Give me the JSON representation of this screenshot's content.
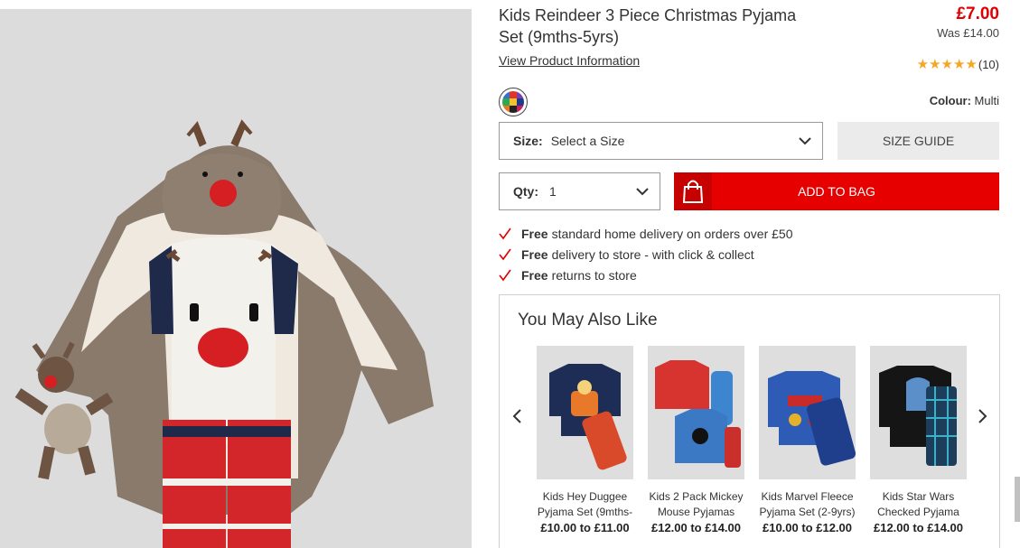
{
  "product": {
    "title": "Kids Reindeer 3 Piece Christmas Pyjama Set (9mths-5yrs)",
    "price_now": "£7.00",
    "price_was": "Was £14.00",
    "view_info_link": "View Product Information",
    "rating_stars": 5,
    "rating_count": "(10)",
    "colour_label": "Colour:",
    "colour_value": "Multi"
  },
  "colors": {
    "accent_red": "#e60000",
    "price_red": "#e00000",
    "star": "#f5a623"
  },
  "size": {
    "label": "Size:",
    "value": "Select a Size",
    "guide_label": "SIZE GUIDE"
  },
  "quantity": {
    "label": "Qty:",
    "value": "1"
  },
  "add_to_bag_label": "ADD TO BAG",
  "benefits": [
    {
      "bold": "Free",
      "text": "standard home delivery on orders over £50"
    },
    {
      "bold": "Free",
      "text": "delivery to store - with click & collect"
    },
    {
      "bold": "Free",
      "text": "returns to store"
    }
  ],
  "recommendations": {
    "title": "You May Also Like",
    "items": [
      {
        "name": "Kids Hey Duggee Pyjama Set (9mths-",
        "price": "£10.00 to £11.00"
      },
      {
        "name": "Kids 2 Pack Mickey Mouse Pyjamas",
        "price": "£12.00 to £14.00"
      },
      {
        "name": "Kids Marvel Fleece Pyjama Set (2-9yrs)",
        "price": "£10.00 to £12.00"
      },
      {
        "name": "Kids Star Wars Checked Pyjama",
        "price": "£12.00 to £14.00"
      }
    ]
  }
}
